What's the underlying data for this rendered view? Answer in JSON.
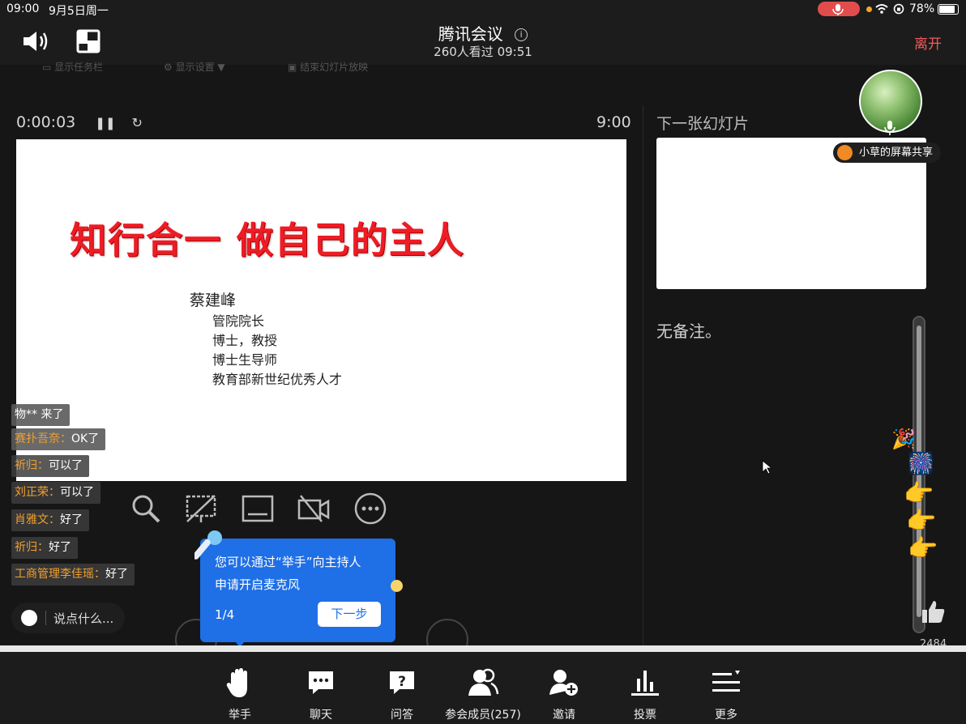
{
  "status_bar": {
    "time": "09:00",
    "date": "9月5日周一",
    "battery": "78%"
  },
  "header": {
    "title": "腾讯会议",
    "subtitle": "260人看过  09:51",
    "leave": "离开"
  },
  "presenter": {
    "faint_toolbar": [
      "显示任务栏",
      "显示设置 ▼",
      "结束幻灯片放映"
    ],
    "elapsed": "0:00:03",
    "clock": "9:00",
    "next_slide_label": "下一张幻灯片",
    "notes": "无备注。",
    "screen_share_label": "小草的屏幕共享",
    "like_count": "2484"
  },
  "slide": {
    "title": "知行合一  做自己的主人",
    "name": "蔡建峰",
    "lines": [
      "管院院长",
      "博士，教授",
      "博士生导师",
      "教育部新世纪优秀人才"
    ]
  },
  "chat": [
    {
      "name": "物**",
      "msg": " 来了"
    },
    {
      "name": "赛扑吾奈：",
      "msg": "OK了"
    },
    {
      "name": "祈归：",
      "msg": "可以了"
    },
    {
      "name": "刘正荣：",
      "msg": "可以了"
    },
    {
      "name": "肖雅文：",
      "msg": "好了"
    },
    {
      "name": "祈归：",
      "msg": "好了"
    },
    {
      "name": "工商管理李佳瑶：",
      "msg": "好了"
    }
  ],
  "chat_input": {
    "placeholder": "说点什么..."
  },
  "tooltip": {
    "line1": "您可以通过“举手”向主持人",
    "line2": "申请开启麦克风",
    "page": "1/4",
    "next": "下一步"
  },
  "bottom_bar": [
    {
      "icon": "raise-hand-icon",
      "label": "举手"
    },
    {
      "icon": "chat-icon",
      "label": "聊天"
    },
    {
      "icon": "qa-icon",
      "label": "问答"
    },
    {
      "icon": "participants-icon",
      "label": "参会成员(257)"
    },
    {
      "icon": "invite-icon",
      "label": "邀请"
    },
    {
      "icon": "poll-icon",
      "label": "投票"
    },
    {
      "icon": "more-icon",
      "label": "更多"
    }
  ],
  "colors": {
    "leave": "#f25b5b",
    "slide_title": "#ee1c25",
    "tooltip": "#1f6fe6",
    "chat_name": "#f0a030"
  }
}
